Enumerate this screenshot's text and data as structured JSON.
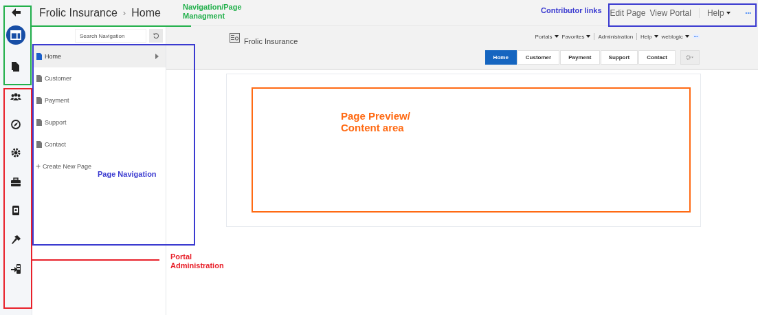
{
  "header": {
    "site": "Frolic Insurance",
    "separator": "›",
    "page": "Home"
  },
  "contributor_links": [
    {
      "label": "Edit Page",
      "kind": "link",
      "dropdown": false
    },
    {
      "label": "View Portal",
      "kind": "link",
      "dropdown": false
    },
    {
      "label": "Help",
      "kind": "link",
      "dropdown": true
    },
    {
      "label": "•••",
      "kind": "more"
    }
  ],
  "rail_items": [
    {
      "selected": false
    },
    {
      "selected": true
    },
    {
      "selected": false
    },
    {
      "selected": false
    },
    {
      "selected": false
    },
    {
      "selected": false
    },
    {
      "selected": false
    },
    {
      "selected": false
    },
    {
      "selected": false
    },
    {
      "selected": false
    }
  ],
  "navigation": {
    "search": {
      "placeholder": "Search Navigation"
    },
    "items": [
      {
        "label": "Home",
        "selected": true
      },
      {
        "label": "Customer",
        "selected": false
      },
      {
        "label": "Payment",
        "selected": false
      },
      {
        "label": "Support",
        "selected": false
      },
      {
        "label": "Contact",
        "selected": false
      }
    ],
    "create": {
      "icon": "+",
      "label": "Create New Page"
    }
  },
  "portal": {
    "name": "Frolic Insurance",
    "menu": [
      {
        "label": "Portals",
        "dropdown": true,
        "kind": "link"
      },
      {
        "label": "Favorites",
        "dropdown": true,
        "kind": "link"
      },
      {
        "label": "Administration",
        "dropdown": false,
        "kind": "link"
      },
      {
        "label": "Help",
        "dropdown": true,
        "kind": "link"
      },
      {
        "label": "weblogic",
        "dropdown": true,
        "kind": "link"
      },
      {
        "label": "•••",
        "kind": "more"
      }
    ],
    "tabs": [
      {
        "label": "Home",
        "selected": true
      },
      {
        "label": "Customer",
        "selected": false
      },
      {
        "label": "Payment",
        "selected": false
      },
      {
        "label": "Support",
        "selected": false
      },
      {
        "label": "Contact",
        "selected": false
      }
    ]
  },
  "annotations": [
    {
      "label": "Navigation/Page Managment",
      "color": "#22b04b"
    },
    {
      "label": "Contributor links",
      "color": "#3a3ad0"
    },
    {
      "label": "Page Navigation",
      "color": "#3a3ad0"
    },
    {
      "label": "Portal Administration",
      "color": "#e8202a"
    },
    {
      "label": "Page Preview/ Content area",
      "color": "#ff6a13"
    }
  ]
}
